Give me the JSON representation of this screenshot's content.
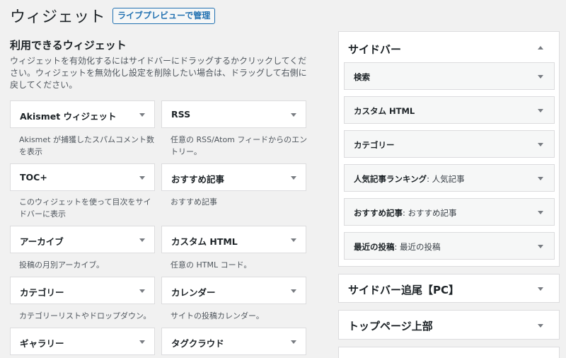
{
  "header": {
    "title": "ウィジェット",
    "preview_button": "ライブプレビューで管理"
  },
  "available": {
    "title": "利用できるウィジェット",
    "description": "ウィジェットを有効化するにはサイドバーにドラッグするかクリックしてください。ウィジェットを無効化し設定を削除したい場合は、ドラッグして右側に戻してください。",
    "widgets": [
      {
        "title": "Akismet ウィジェット",
        "desc": "Akismet が捕獲したスパムコメント数を表示"
      },
      {
        "title": "RSS",
        "desc": "任意の RSS/Atom フィードからのエントリー。"
      },
      {
        "title": "TOC+",
        "desc": "このウィジェットを使って目次をサイドバーに表示"
      },
      {
        "title": "おすすめ記事",
        "desc": "おすすめ記事"
      },
      {
        "title": "アーカイブ",
        "desc": "投稿の月別アーカイブ。"
      },
      {
        "title": "カスタム HTML",
        "desc": "任意の HTML コード。"
      },
      {
        "title": "カテゴリー",
        "desc": "カテゴリーリストやドロップダウン。"
      },
      {
        "title": "カレンダー",
        "desc": "サイトの投稿カレンダー。"
      },
      {
        "title": "ギャラリー",
        "desc": ""
      },
      {
        "title": "タグクラウド",
        "desc": ""
      }
    ]
  },
  "areas": {
    "sidebar": {
      "title": "サイドバー",
      "items": [
        {
          "title": "検索",
          "subtitle": ""
        },
        {
          "title": "カスタム HTML",
          "subtitle": ""
        },
        {
          "title": "カテゴリー",
          "subtitle": ""
        },
        {
          "title": "人気記事ランキング",
          "subtitle": ": 人気記事"
        },
        {
          "title": "おすすめ記事",
          "subtitle": ": おすすめ記事"
        },
        {
          "title": "最近の投稿",
          "subtitle": ": 最近の投稿"
        }
      ]
    },
    "sidebar_follow": {
      "title": "サイドバー追尾【PC】"
    },
    "top_page": {
      "title": "トップページ上部"
    }
  },
  "icons": {
    "collapse": "chevron-down-icon",
    "expand": "chevron-up-icon"
  },
  "colors": {
    "accent": "#2271b1",
    "background": "#f1f1f1",
    "panel": "#ffffff"
  }
}
